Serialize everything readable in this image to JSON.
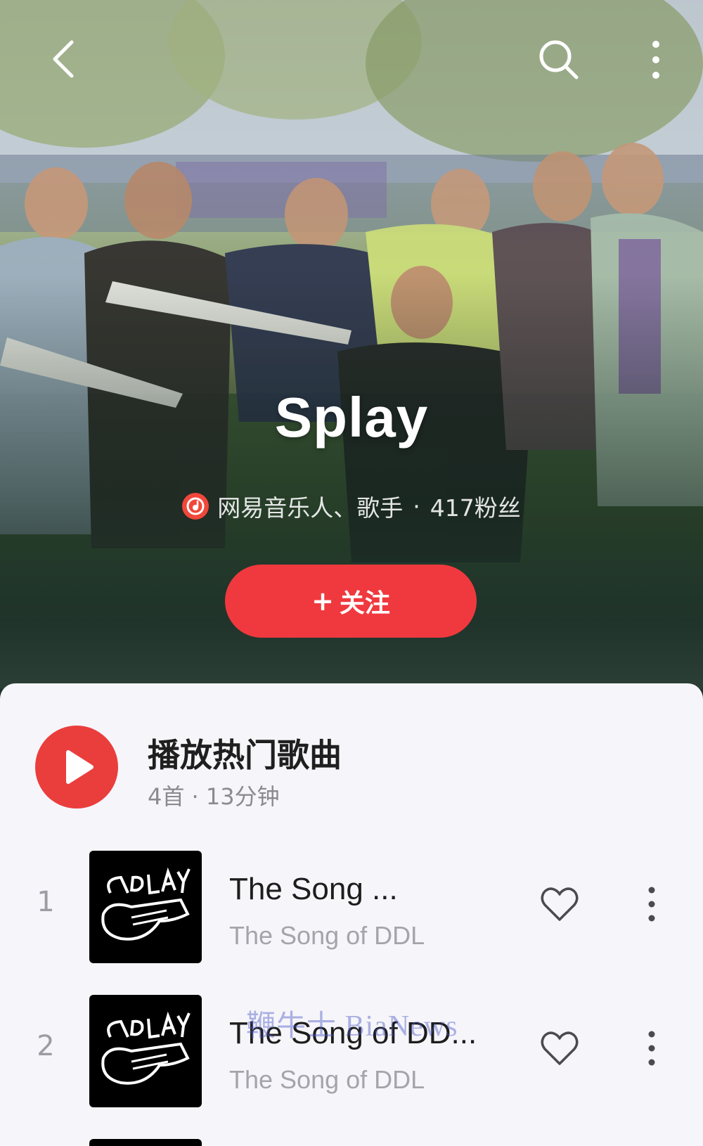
{
  "artist": {
    "name": "Splay",
    "role": "网易音乐人、歌手",
    "separator": "·",
    "fans": "417粉丝",
    "follow_label": "关注",
    "follow_plus": "+"
  },
  "play_all": {
    "title": "播放热门歌曲",
    "subtitle": "4首 · 13分钟"
  },
  "songs": [
    {
      "rank": "1",
      "title": "The Song ...",
      "subtitle": "The Song of DDL"
    },
    {
      "rank": "2",
      "title": "The Song of DD...",
      "subtitle": "The Song of DDL"
    }
  ],
  "watermark": "鞭牛士 BiaNews",
  "colors": {
    "accent": "#f0393e",
    "play": "#ea3e3d",
    "sheet_bg": "#f6f6fa",
    "header_dark": "#2b3f36"
  },
  "icons": {
    "back": "back-arrow-icon",
    "search": "search-icon",
    "more": "more-vertical-icon",
    "badge": "netease-musician-badge-icon",
    "play": "play-icon",
    "like": "heart-icon"
  }
}
